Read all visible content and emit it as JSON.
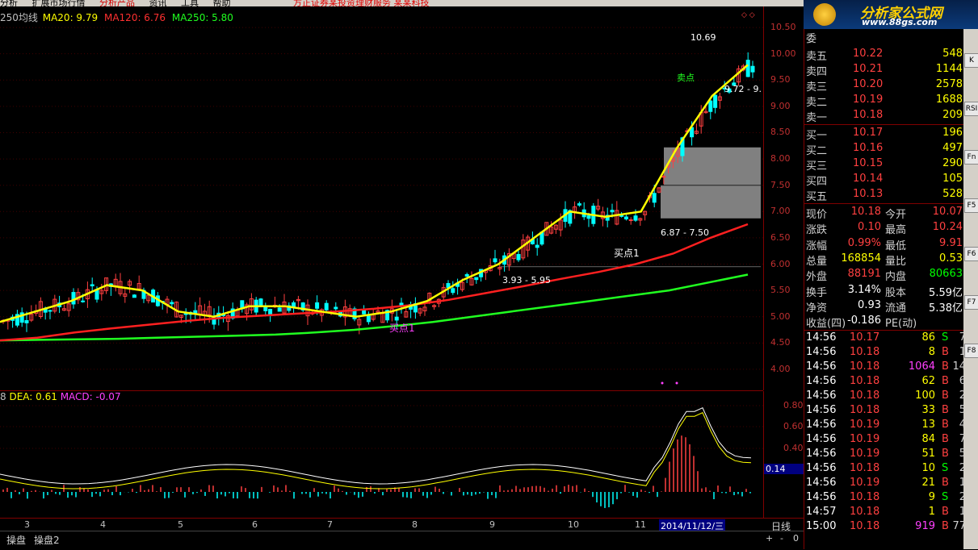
{
  "menu": {
    "items": [
      "分析",
      "扩展市场行情",
      "分析产品",
      "资讯",
      "工具",
      "帮助"
    ],
    "promo": "方正证券某投资理财服务 某某科技"
  },
  "main_indicator": {
    "title": "250均线",
    "ma20": "MA20: 9.79",
    "ma120": "MA120: 6.76",
    "ma250": "MA250: 5.80"
  },
  "price_axis": [
    "10.50",
    "10.00",
    "9.50",
    "9.00",
    "8.50",
    "8.00",
    "7.50",
    "7.00",
    "6.50",
    "6.00",
    "5.50",
    "5.00",
    "4.50",
    "4.00"
  ],
  "annotations": {
    "high": "10.69",
    "range1": "9.72 - 9.",
    "range2": "6.87 - 7.50",
    "range3": "3.93 - 5.95",
    "buy1": "买点1",
    "buy2": "买点1",
    "sell": "卖点"
  },
  "macd_indicator": {
    "prefix": "8",
    "dea": "DEA: 0.61",
    "macd": "MACD: -0.07"
  },
  "macd_axis": [
    "0.80",
    "0.60",
    "0.40"
  ],
  "macd_current": "0.14",
  "date_axis": [
    "3",
    "4",
    "5",
    "6",
    "7",
    "8",
    "9",
    "10",
    "11"
  ],
  "cursor_date": "2014/11/12/三",
  "period": "日线",
  "bottom_tabs": [
    "操盘",
    "操盘2"
  ],
  "scroll_buttons": [
    "+",
    "-",
    "0"
  ],
  "logo": {
    "text": "分析家公式网",
    "url": "www.88gs.com"
  },
  "quote": {
    "header": "委",
    "asks": [
      {
        "label": "卖五",
        "price": "10.22",
        "vol": "548"
      },
      {
        "label": "卖四",
        "price": "10.21",
        "vol": "1144"
      },
      {
        "label": "卖三",
        "price": "10.20",
        "vol": "2578"
      },
      {
        "label": "卖二",
        "price": "10.19",
        "vol": "1688"
      },
      {
        "label": "卖一",
        "price": "10.18",
        "vol": "209"
      }
    ],
    "bids": [
      {
        "label": "买一",
        "price": "10.17",
        "vol": "196"
      },
      {
        "label": "买二",
        "price": "10.16",
        "vol": "497"
      },
      {
        "label": "买三",
        "price": "10.15",
        "vol": "290"
      },
      {
        "label": "买四",
        "price": "10.14",
        "vol": "105"
      },
      {
        "label": "买五",
        "price": "10.13",
        "vol": "528"
      }
    ],
    "stats": [
      {
        "l1": "现价",
        "v1": "10.18",
        "l2": "今开",
        "v2": "10.07",
        "c1": "#ff4040",
        "c2": "#ff4040"
      },
      {
        "l1": "涨跌",
        "v1": "0.10",
        "l2": "最高",
        "v2": "10.24",
        "c1": "#ff4040",
        "c2": "#ff4040"
      },
      {
        "l1": "涨幅",
        "v1": "0.99%",
        "l2": "最低",
        "v2": "9.91",
        "c1": "#ff4040",
        "c2": "#ff4040"
      },
      {
        "l1": "总量",
        "v1": "168854",
        "l2": "量比",
        "v2": "0.53",
        "c1": "#ffff00",
        "c2": "#ffff00"
      },
      {
        "l1": "外盘",
        "v1": "88191",
        "l2": "内盘",
        "v2": "80663",
        "c1": "#ff4040",
        "c2": "#00ff00"
      },
      {
        "l1": "换手",
        "v1": "3.14%",
        "l2": "股本",
        "v2": "5.59亿",
        "c1": "#ffffff",
        "c2": "#ffffff"
      },
      {
        "l1": "净资",
        "v1": "0.93",
        "l2": "流通",
        "v2": "5.38亿",
        "c1": "#ffffff",
        "c2": "#ffffff"
      },
      {
        "l1": "收益(四)",
        "v1": "-0.186",
        "l2": "PE(动)",
        "v2": "",
        "c1": "#ffffff",
        "c2": "#ffffff"
      }
    ],
    "ticks": [
      {
        "t": "14:56",
        "p": "10.17",
        "v": "86",
        "s": "S",
        "n": "7"
      },
      {
        "t": "14:56",
        "p": "10.18",
        "v": "8",
        "s": "B",
        "n": "1"
      },
      {
        "t": "14:56",
        "p": "10.18",
        "v": "1064",
        "s": "B",
        "n": "14"
      },
      {
        "t": "14:56",
        "p": "10.18",
        "v": "62",
        "s": "B",
        "n": "6"
      },
      {
        "t": "14:56",
        "p": "10.18",
        "v": "100",
        "s": "B",
        "n": "2"
      },
      {
        "t": "14:56",
        "p": "10.18",
        "v": "33",
        "s": "B",
        "n": "5"
      },
      {
        "t": "14:56",
        "p": "10.19",
        "v": "13",
        "s": "B",
        "n": "4"
      },
      {
        "t": "14:56",
        "p": "10.19",
        "v": "84",
        "s": "B",
        "n": "7"
      },
      {
        "t": "14:56",
        "p": "10.19",
        "v": "51",
        "s": "B",
        "n": "5"
      },
      {
        "t": "14:56",
        "p": "10.18",
        "v": "10",
        "s": "S",
        "n": "2"
      },
      {
        "t": "14:56",
        "p": "10.19",
        "v": "21",
        "s": "B",
        "n": "1"
      },
      {
        "t": "14:56",
        "p": "10.18",
        "v": "9",
        "s": "S",
        "n": "2"
      },
      {
        "t": "14:57",
        "p": "10.18",
        "v": "1",
        "s": "B",
        "n": "1"
      },
      {
        "t": "15:00",
        "p": "10.18",
        "v": "919",
        "s": "B",
        "n": "77"
      }
    ]
  },
  "sidebar_buttons": [
    "K",
    "RSI",
    "Fn",
    "F5",
    "F6",
    "F7",
    "F8"
  ],
  "colors": {
    "up": "#ff4040",
    "down": "#00ffff",
    "ma20": "#ffff00",
    "ma120": "#ff2020",
    "ma250": "#20ff20",
    "grid": "#800000"
  },
  "chart_data": {
    "type": "line",
    "title": "",
    "ylim": [
      3.6,
      10.9
    ],
    "ma20": [
      4.9,
      5.1,
      5.3,
      5.6,
      5.5,
      5.1,
      5.0,
      5.2,
      5.2,
      5.1,
      5.0,
      5.1,
      5.3,
      5.7,
      6.0,
      6.5,
      7.0,
      6.9,
      7.0,
      8.2,
      9.2,
      9.79
    ],
    "ma120": [
      4.55,
      4.6,
      4.7,
      4.78,
      4.85,
      4.92,
      4.98,
      5.02,
      5.06,
      5.1,
      5.15,
      5.22,
      5.32,
      5.45,
      5.58,
      5.72,
      5.85,
      6.0,
      6.2,
      6.5,
      6.76
    ],
    "ma250": [
      4.55,
      4.56,
      4.57,
      4.58,
      4.6,
      4.62,
      4.64,
      4.66,
      4.7,
      4.75,
      4.82,
      4.9,
      5.0,
      5.1,
      5.2,
      5.3,
      5.4,
      5.5,
      5.65,
      5.8
    ]
  }
}
